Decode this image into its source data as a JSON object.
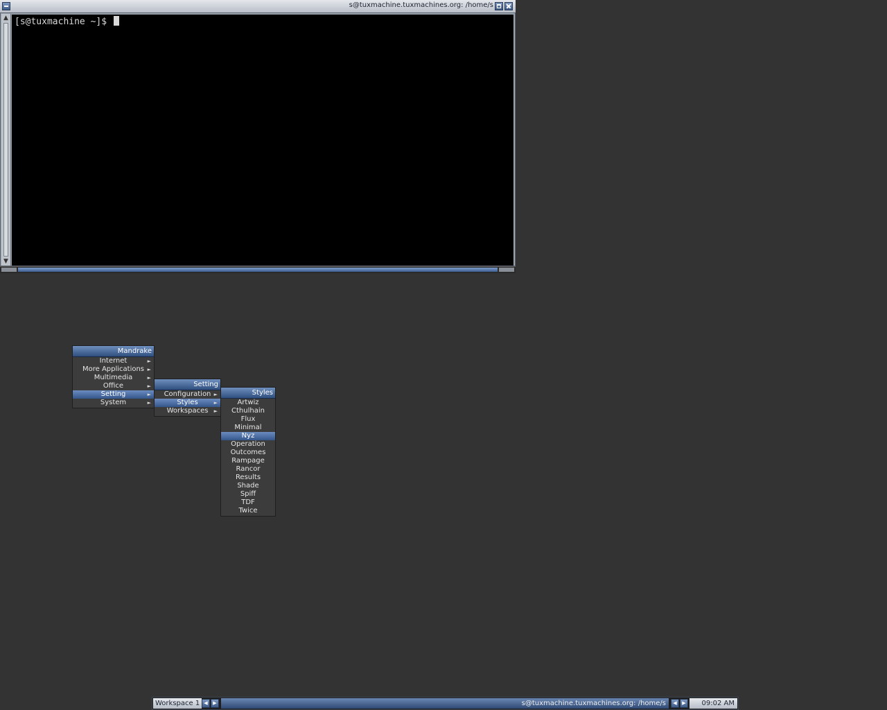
{
  "terminal": {
    "title": "s@tuxmachine.tuxmachines.org: /home/s",
    "prompt": "[s@tuxmachine ~]$ "
  },
  "menus": {
    "root": {
      "title": "Mandrake",
      "items": [
        "Internet",
        "More Applications",
        "Multimedia",
        "Office",
        "Setting",
        "System"
      ]
    },
    "setting": {
      "title": "Setting",
      "items": [
        "Configuration",
        "Styles",
        "Workspaces"
      ]
    },
    "styles": {
      "title": "Styles",
      "items": [
        "Artwiz",
        "Cthulhain",
        "Flux",
        "Minimal",
        "Nyz",
        "Operation",
        "Outcomes",
        "Rampage",
        "Rancor",
        "Results",
        "Shade",
        "Spiff",
        "TDF",
        "Twice"
      ]
    }
  },
  "toolbar": {
    "workspace": "Workspace 1",
    "window": "s@tuxmachine.tuxmachines.org: /home/s",
    "clock": "09:02 AM"
  },
  "colors": {
    "desktop": "#333333",
    "accent": "#4a6fa5",
    "menu_bg": "#3c3c3c",
    "terminal_bg": "#000000"
  }
}
